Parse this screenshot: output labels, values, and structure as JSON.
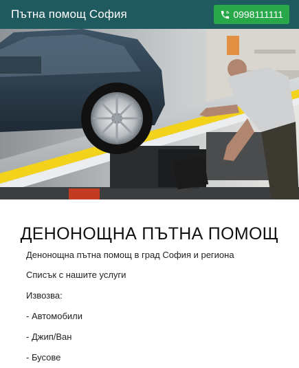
{
  "header": {
    "brand": "Пътна помощ София",
    "phone": "0998111111",
    "phone_icon": "phone-icon",
    "colors": {
      "bar": "#1f5a5e",
      "button": "#29a84a"
    }
  },
  "hero": {
    "image": "tow-truck-photo"
  },
  "main": {
    "title": "ДЕНОНОЩНА ПЪТНА ПОМОЩ",
    "lines": [
      "Денонощна пътна помощ в град София и региона",
      "Списък с нашите услуги",
      "Извозва:",
      "- Автомобили",
      "- Джип/Ван",
      "- Бусове"
    ]
  }
}
